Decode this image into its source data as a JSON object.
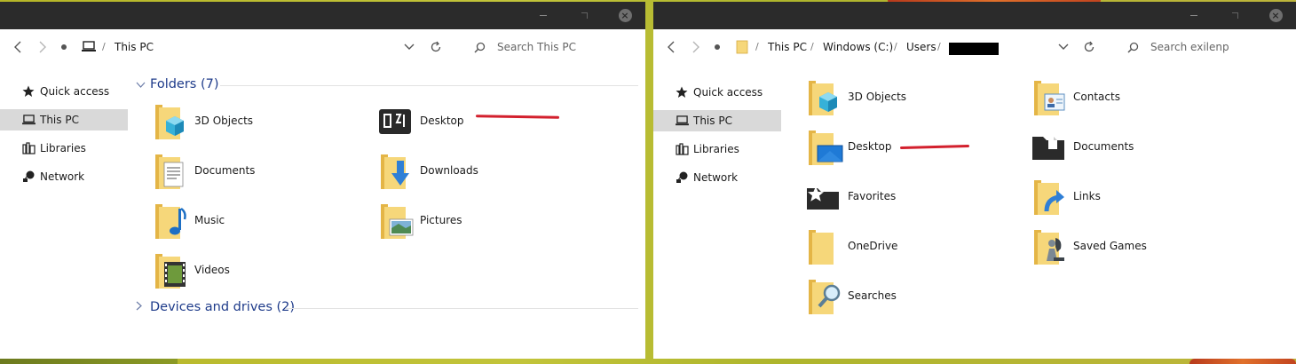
{
  "colors": {
    "titlebar": "#2b2b2b",
    "selection": "#d9d9d9",
    "group_header": "#1e3b8a",
    "folder_yellow": "#f2c95a",
    "annotation_red": "#d3202d",
    "desktop_bg": "#b5b527"
  },
  "window_left": {
    "breadcrumb": [
      "This PC"
    ],
    "search_placeholder": "Search This PC",
    "sidebar": [
      {
        "label": "Quick access",
        "icon": "star-icon"
      },
      {
        "label": "This PC",
        "icon": "computer-icon",
        "selected": true
      },
      {
        "label": "Libraries",
        "icon": "libraries-icon"
      },
      {
        "label": "Network",
        "icon": "network-icon"
      }
    ],
    "groups": [
      {
        "title": "Folders (7)",
        "expanded": true
      },
      {
        "title": "Devices and drives (2)",
        "expanded": false
      }
    ],
    "folders": [
      {
        "label": "3D Objects",
        "icon": "3d-objects-folder-icon"
      },
      {
        "label": "Desktop",
        "icon": "desktop-folder-icon"
      },
      {
        "label": "Documents",
        "icon": "documents-folder-icon"
      },
      {
        "label": "Downloads",
        "icon": "downloads-folder-icon"
      },
      {
        "label": "Music",
        "icon": "music-folder-icon"
      },
      {
        "label": "Pictures",
        "icon": "pictures-folder-icon"
      },
      {
        "label": "Videos",
        "icon": "videos-folder-icon"
      }
    ]
  },
  "window_right": {
    "breadcrumb": [
      "This PC",
      "Windows (C:)",
      "Users"
    ],
    "search_placeholder": "Search exilenp",
    "sidebar": [
      {
        "label": "Quick access",
        "icon": "star-icon"
      },
      {
        "label": "This PC",
        "icon": "computer-icon",
        "selected": true
      },
      {
        "label": "Libraries",
        "icon": "libraries-icon"
      },
      {
        "label": "Network",
        "icon": "network-icon"
      }
    ],
    "folders": [
      {
        "label": "3D Objects",
        "icon": "3d-objects-folder-icon"
      },
      {
        "label": "Contacts",
        "icon": "contacts-folder-icon"
      },
      {
        "label": "Desktop",
        "icon": "desktop-folder-icon"
      },
      {
        "label": "Documents",
        "icon": "documents-folder-icon"
      },
      {
        "label": "Favorites",
        "icon": "favorites-folder-icon"
      },
      {
        "label": "Links",
        "icon": "links-folder-icon"
      },
      {
        "label": "OneDrive",
        "icon": "onedrive-folder-icon"
      },
      {
        "label": "Saved Games",
        "icon": "saved-games-folder-icon"
      },
      {
        "label": "Searches",
        "icon": "searches-folder-icon"
      }
    ]
  }
}
